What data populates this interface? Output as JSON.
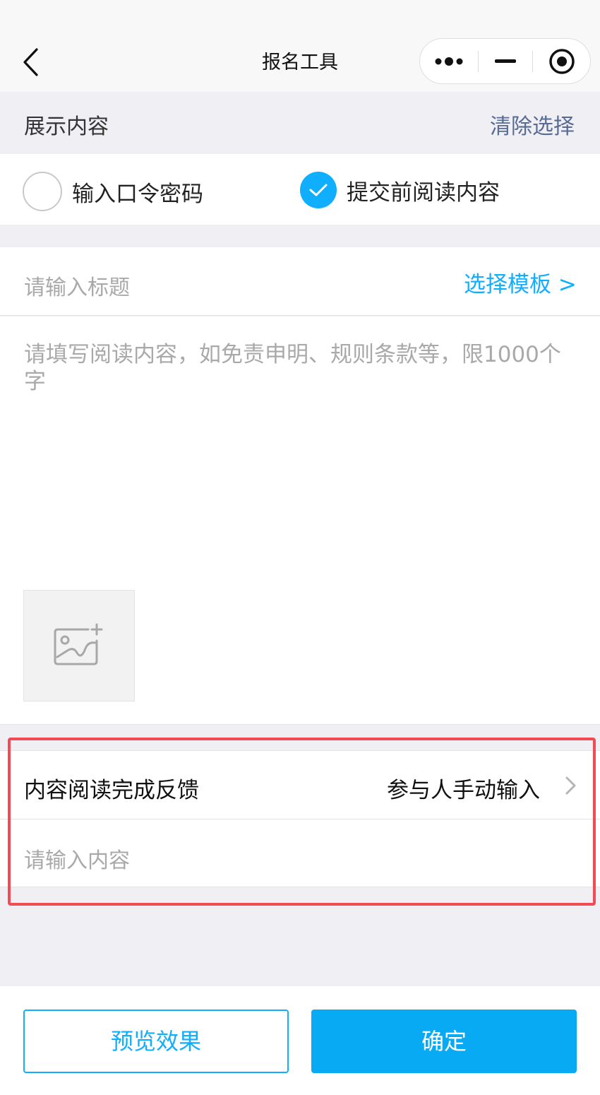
{
  "navbar": {
    "title": "报名工具",
    "icons": [
      "back-chevron-icon",
      "more-dots-icon",
      "minimize-icon",
      "close-target-icon"
    ]
  },
  "section": {
    "title": "展示内容",
    "clear_label": "清除选择"
  },
  "options": [
    {
      "label": "输入口令密码",
      "checked": false
    },
    {
      "label": "提交前阅读内容",
      "checked": true
    }
  ],
  "title_input": {
    "placeholder": "请输入标题",
    "template_link": "选择模板 >"
  },
  "content_input": {
    "placeholder": "请填写阅读内容，如免责申明、规则条款等，限1000个字",
    "image_icon": "add-image-icon"
  },
  "feedback": {
    "label": "内容阅读完成反馈",
    "value": "参与人手动输入",
    "input_placeholder": "请输入内容"
  },
  "footer": {
    "preview_label": "预览效果",
    "confirm_label": "确定"
  },
  "colors": {
    "accent": "#10aeff",
    "link": "#576b95",
    "highlight": "#f24b55",
    "background": "#efeff4"
  }
}
